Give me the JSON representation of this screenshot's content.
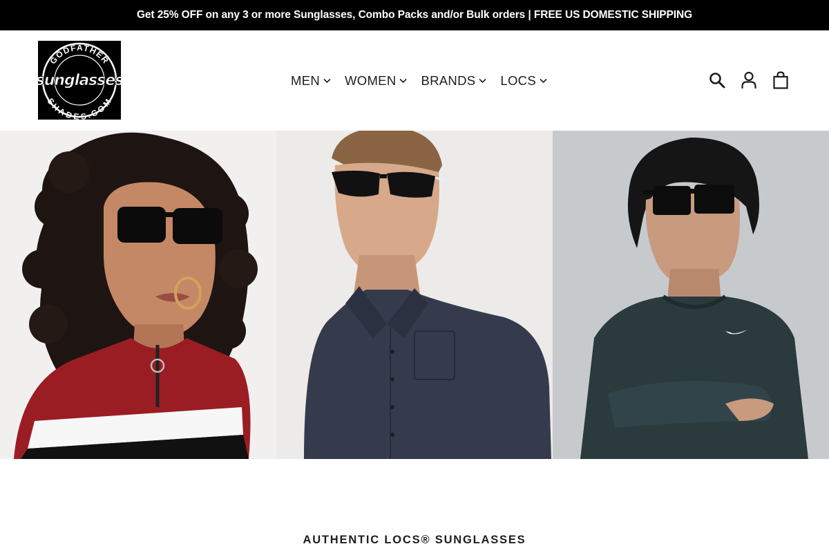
{
  "announcement": {
    "text": "Get 25% OFF on any 3 or more Sunglasses, Combo Packs and/or Bulk orders | FREE US DOMESTIC SHIPPING"
  },
  "logo": {
    "top_text": "GODFATHER",
    "script_text": "sunglasses",
    "bottom_text": "SHADES.COM"
  },
  "nav": {
    "items": [
      {
        "label": "MEN"
      },
      {
        "label": "WOMEN"
      },
      {
        "label": "BRANDS"
      },
      {
        "label": "LOCS"
      }
    ]
  },
  "header_icons": [
    "search-icon",
    "account-icon",
    "cart-icon"
  ],
  "hero": {
    "panels": [
      {
        "name": "woman-curly-hair-sunglasses",
        "bg": "#f0efee"
      },
      {
        "name": "man-sport-sunglasses",
        "bg": "#ecebea"
      },
      {
        "name": "young-man-square-sunglasses",
        "bg": "#c6c9cc"
      }
    ]
  },
  "section": {
    "title": "AUTHENTIC LOCS® SUNGLASSES"
  },
  "colors": {
    "announcement_bg": "#000000",
    "text": "#1c1d1d"
  }
}
